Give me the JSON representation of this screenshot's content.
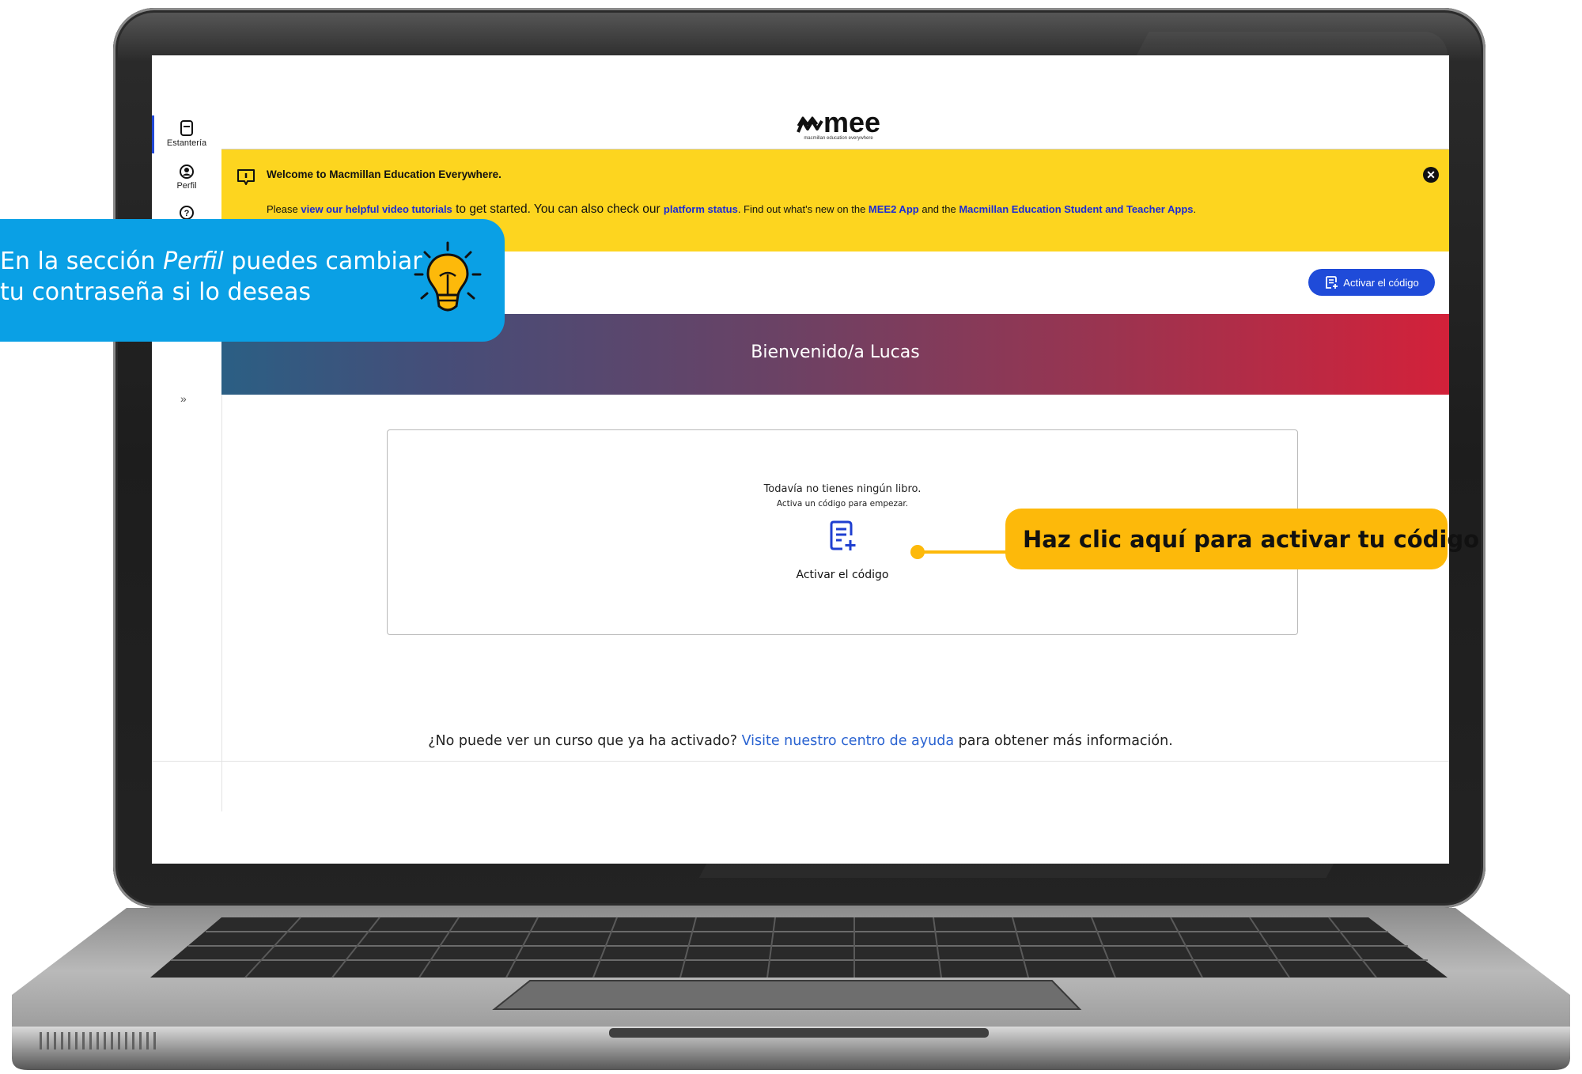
{
  "sidebar": {
    "items": [
      {
        "label": "Estantería",
        "icon": "book-icon"
      },
      {
        "label": "Perfil",
        "icon": "profile-icon"
      },
      {
        "label": "",
        "icon": "help-icon"
      }
    ],
    "expand_label": "»"
  },
  "header": {
    "logo_text": "mee",
    "logo_subtext": "macmillan education everywhere"
  },
  "banner": {
    "title": "Welcome to Macmillan Education Everywhere.",
    "text_1": "Please ",
    "link_1": "view our helpful video tutorials",
    "text_2": " to get started. You can also check our ",
    "link_2": "platform status",
    "text_3": ". Find out what's new on the ",
    "link_3": "MEE2 App",
    "text_4": " and the ",
    "link_4": "Macmillan Education Student and Teacher Apps",
    "text_5": ".",
    "close_label": "✕",
    "color": "#fdd51f"
  },
  "toolbar": {
    "activate_label": "Activar el código"
  },
  "hero": {
    "title": "Bienvenido/a Lucas"
  },
  "empty_state": {
    "line_1": "Todavía no tienes ningún libro.",
    "line_2": "Activa un código para empezar.",
    "link_label": "Activar el código"
  },
  "footer": {
    "text_1": "¿No puede ver un curso que ya ha activado? ",
    "link": "Visite nuestro centro de ayuda",
    "text_2": " para obtener más información."
  },
  "callouts": {
    "blue_line_1_pre": "En la sección ",
    "blue_line_1_em": "Perfil",
    "blue_line_1_post": " puedes cambiar",
    "blue_line_2": "tu contraseña si lo deseas",
    "yellow": "Haz clic aquí para activar tu código"
  },
  "colors": {
    "accent": "#1f4bd9",
    "callout_blue": "#0aa0e5",
    "callout_yellow": "#fdb90a"
  }
}
